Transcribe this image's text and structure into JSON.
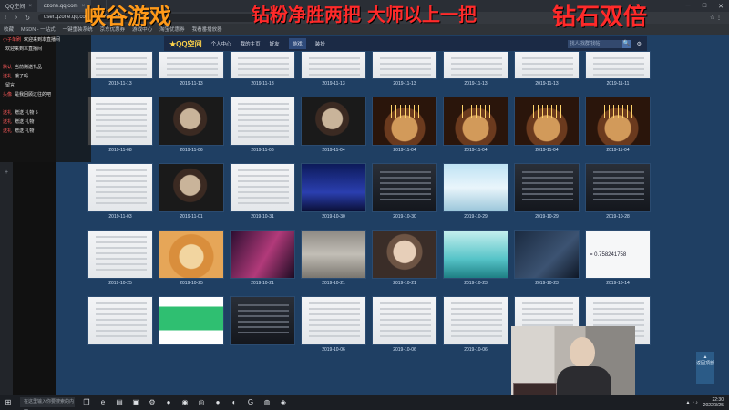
{
  "browser": {
    "tabs": [
      {
        "label": "QQ空间",
        "active": false
      },
      {
        "label": "qzone.qq.com",
        "active": true
      }
    ],
    "url": "user.qzone.qq.com/...4/infocenter",
    "addr_right": "☆ ⋮",
    "bookmarks": [
      "收藏",
      "MSDN - 一站式",
      "一键重装系统",
      "京东优惠券",
      "游戏中心",
      "淘宝优惠券",
      "我看番播放器"
    ]
  },
  "overlay": {
    "title_left": "峡谷游戏",
    "title_mid": "钻粉净胜两把 大师以上一把",
    "title_right": "钻石双倍"
  },
  "qzone": {
    "logo": "★QQ空间",
    "links": [
      "个人中心",
      "我的主页",
      "好友",
      "游戏",
      "装扮"
    ],
    "active_link": 3,
    "search_placeholder": "找人/找群/找帖",
    "search_btn": "🔍"
  },
  "grid": {
    "rows": [
      [
        {
          "style": "t-light",
          "date": "2019-11-13"
        },
        {
          "style": "t-light",
          "date": "2019-11-13"
        },
        {
          "style": "t-light",
          "date": "2019-11-13"
        },
        {
          "style": "t-light",
          "date": "2019-11-13"
        },
        {
          "style": "t-light",
          "date": "2019-11-13"
        },
        {
          "style": "t-light",
          "date": "2019-11-13"
        },
        {
          "style": "t-light",
          "date": "2019-11-13"
        },
        {
          "style": "t-light",
          "date": "2019-11-11"
        }
      ],
      [
        {
          "style": "t-light",
          "date": "2019-11-08"
        },
        {
          "style": "t-person",
          "date": "2019-11-06"
        },
        {
          "style": "t-light",
          "date": "2019-11-06"
        },
        {
          "style": "t-person",
          "date": "2019-11-04"
        },
        {
          "style": "t-cake",
          "date": "2019-11-04"
        },
        {
          "style": "t-cake",
          "date": "2019-11-04"
        },
        {
          "style": "t-cake",
          "date": "2019-11-04"
        },
        {
          "style": "t-cake",
          "date": "2019-11-04"
        }
      ],
      [
        {
          "style": "t-light",
          "date": "2019-11-03"
        },
        {
          "style": "t-person",
          "date": "2019-11-01"
        },
        {
          "style": "t-light",
          "date": "2019-10-31"
        },
        {
          "style": "t-blue",
          "date": "2019-10-30"
        },
        {
          "style": "t-dark",
          "date": "2019-10-30"
        },
        {
          "style": "t-sky",
          "date": "2019-10-29"
        },
        {
          "style": "t-dark",
          "date": "2019-10-29"
        },
        {
          "style": "t-dark",
          "date": "2019-10-28"
        }
      ],
      [
        {
          "style": "t-light",
          "date": "2019-10-25"
        },
        {
          "style": "t-shiba",
          "date": "2019-10-25"
        },
        {
          "style": "t-pink",
          "date": "2019-10-21"
        },
        {
          "style": "t-wall",
          "date": "2019-10-21"
        },
        {
          "style": "t-face",
          "date": "2019-10-21"
        },
        {
          "style": "t-teal",
          "date": "2019-10-23"
        },
        {
          "style": "t-gun",
          "date": "2019-10-23"
        },
        {
          "style": "t-num",
          "date": "2019-10-14",
          "text": "= 0.758241758"
        }
      ],
      [
        {
          "style": "t-light",
          "date": ""
        },
        {
          "style": "t-green",
          "date": ""
        },
        {
          "style": "t-dark",
          "date": ""
        },
        {
          "style": "t-light",
          "date": "2019-10-06"
        },
        {
          "style": "t-light",
          "date": "2019-10-06"
        },
        {
          "style": "t-light",
          "date": "2019-10-06"
        },
        {
          "style": "t-light",
          "date": "2019-10-06"
        },
        {
          "style": "t-light",
          "date": ""
        }
      ]
    ]
  },
  "side_button": "返回顶部",
  "chat": [
    {
      "user": "小子单刷",
      "msg": "欢迎来到本直播间"
    },
    {
      "user": "",
      "msg": "欢迎来到本直播间"
    },
    {
      "user": "",
      "msg": ""
    },
    {
      "user": "默认",
      "msg": "当前赠送礼品"
    },
    {
      "user": "送礼",
      "msg": "饿了吗"
    },
    {
      "user": "",
      "msg": "留言"
    },
    {
      "user": "头像",
      "msg": "是我回顾过往的吧"
    },
    {
      "user": "",
      "msg": ""
    },
    {
      "user": "送礼",
      "msg": "赠送 礼物 5"
    },
    {
      "user": "送礼",
      "msg": "赠送 礼物"
    },
    {
      "user": "送礼",
      "msg": "赠送 礼物"
    }
  ],
  "taskbar": {
    "search": "在这里输入你要搜索的内容",
    "time": "22:30",
    "date": "2022/3/25"
  }
}
